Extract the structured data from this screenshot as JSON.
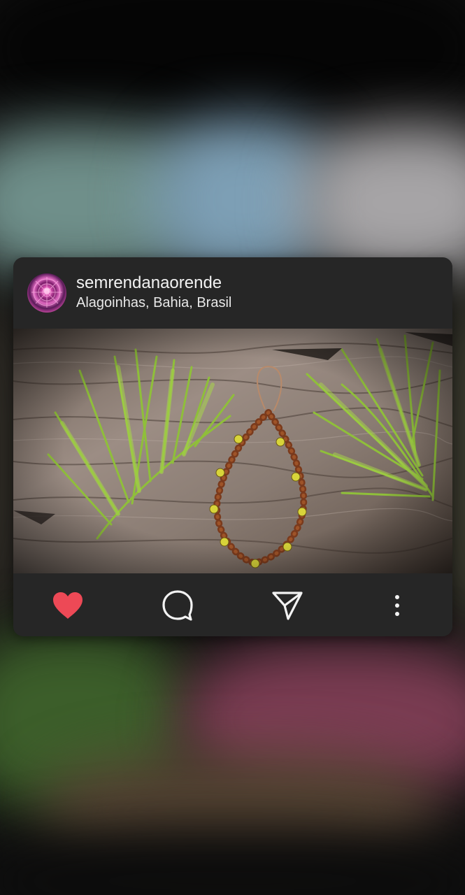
{
  "post": {
    "username": "semrendanaorende",
    "location": "Alagoinhas, Bahia, Brasil",
    "avatar_icon": "avatar-pink-mandala",
    "image_description_icon": "photo-bead-bracelet-palm-leaves"
  },
  "actions": [
    {
      "name": "like",
      "icon": "heart-icon",
      "state": "liked",
      "color": "#ed4956"
    },
    {
      "name": "comment",
      "icon": "comment-icon"
    },
    {
      "name": "share",
      "icon": "send-icon"
    },
    {
      "name": "more",
      "icon": "more-vertical-icon"
    }
  ],
  "colors": {
    "card_background": "#262626",
    "text_primary": "#f2f2f2",
    "like_red": "#ed4956"
  }
}
